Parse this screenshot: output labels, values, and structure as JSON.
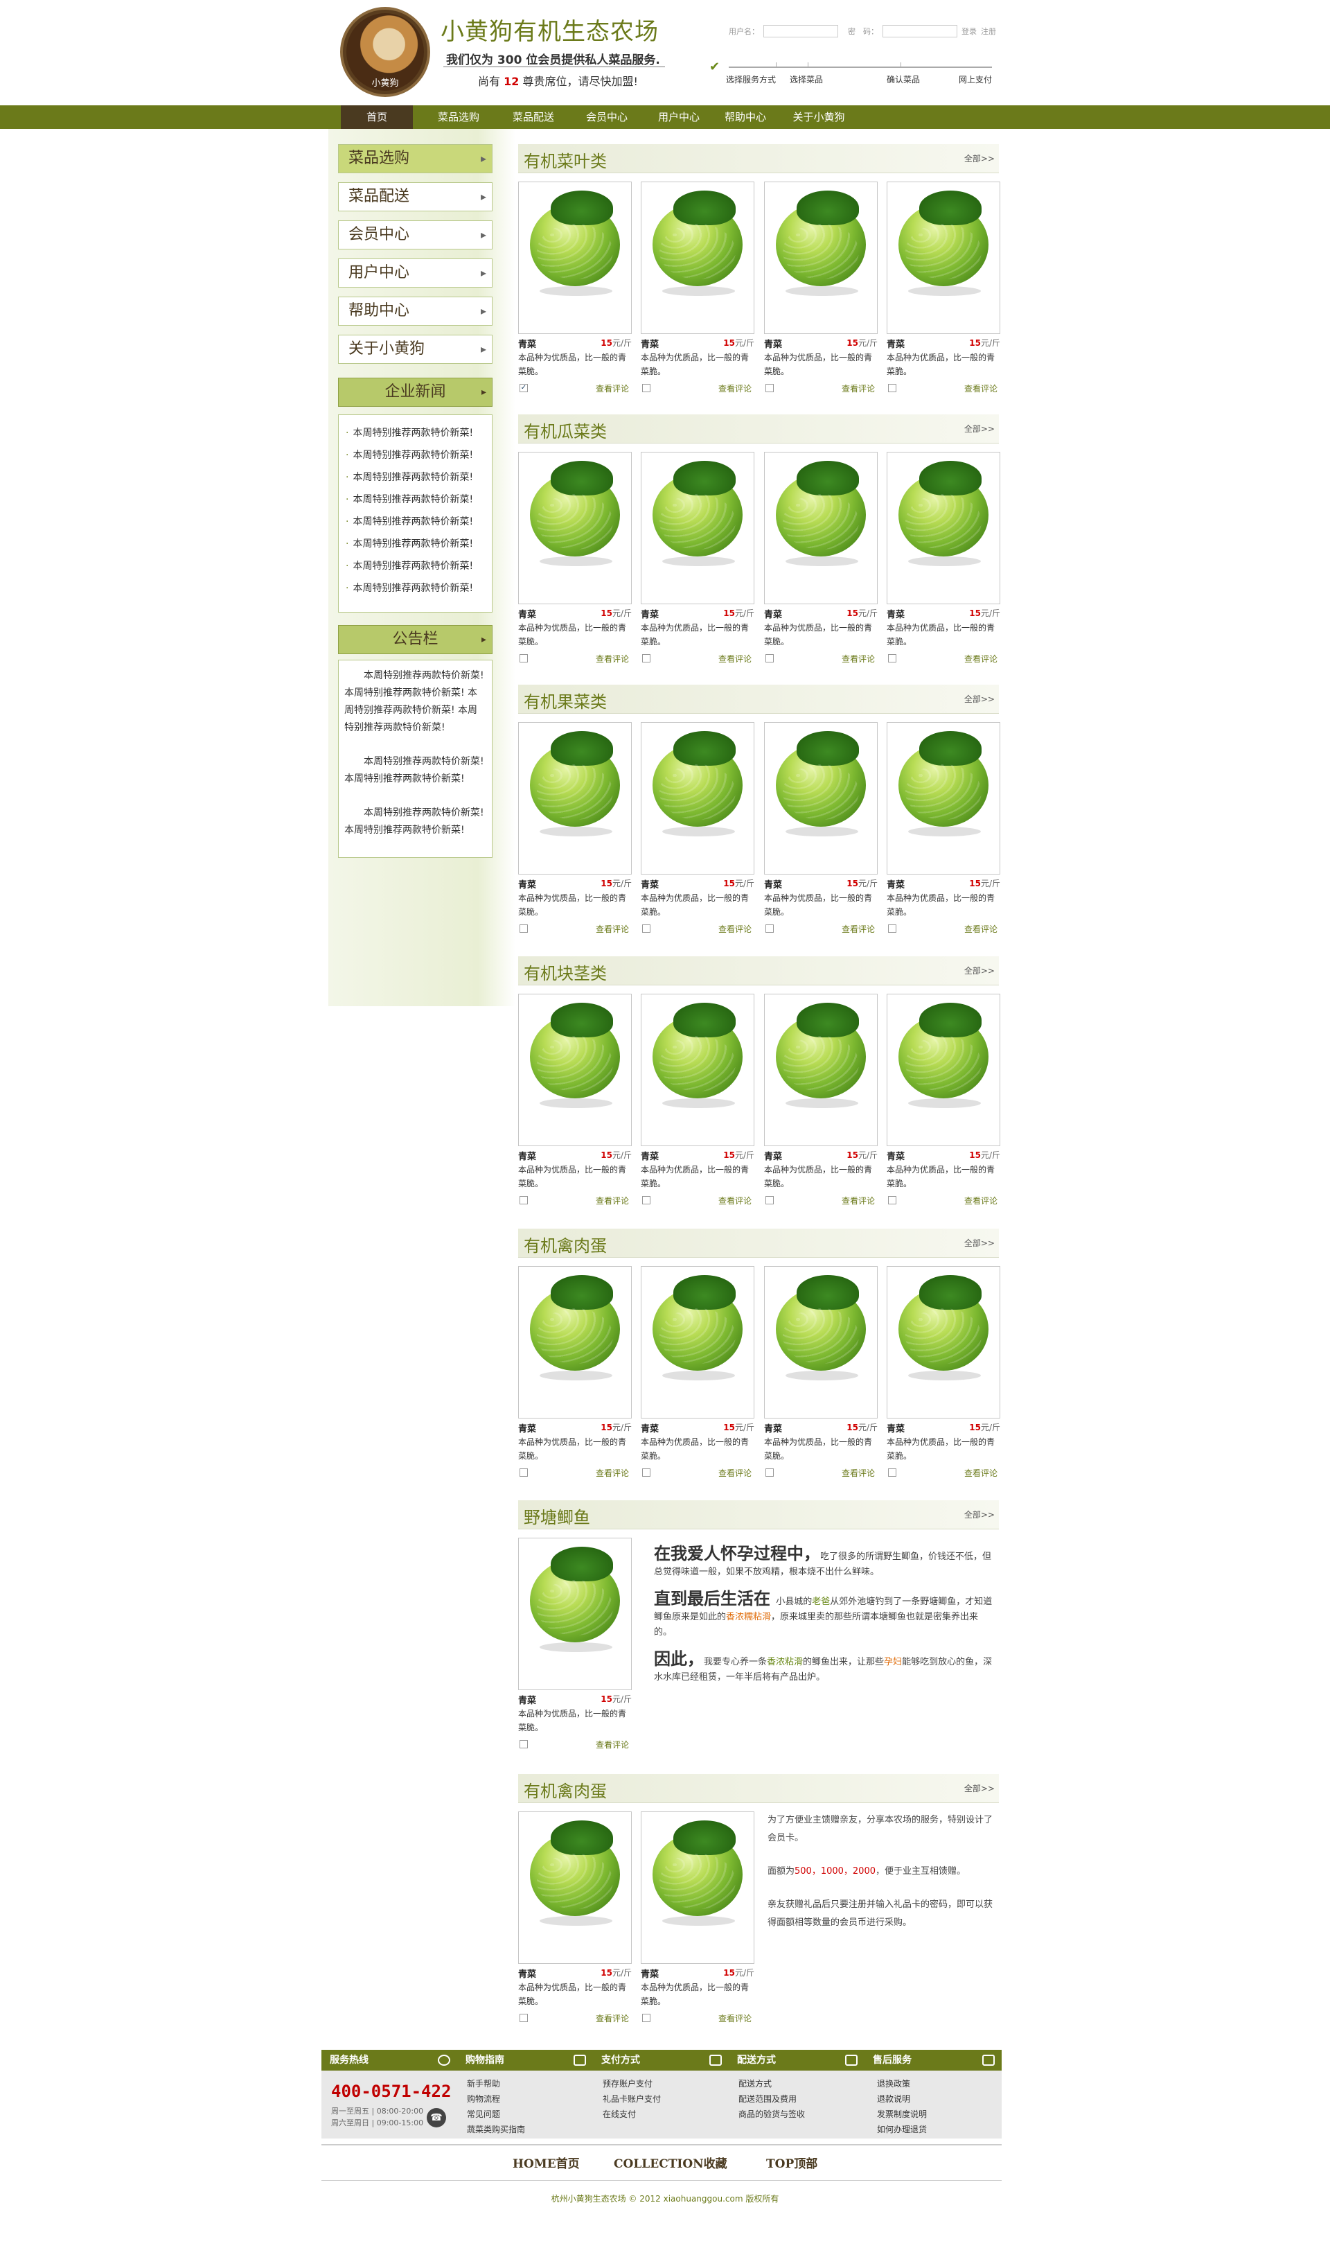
{
  "header": {
    "logo_text": "小黄狗",
    "site_title": "小黄狗有机生态农场",
    "slogan_line1": "我们仅为 300 位会员提供私人菜品服务.",
    "slogan_line2_pre": "尚有 ",
    "slogan_line2_num": "12",
    "slogan_line2_post": " 尊贵席位，请尽快加盟!",
    "login": {
      "username_label": "用户名：",
      "password_label": "密　码：",
      "login_link": "登录",
      "register_link": "注册"
    },
    "steps": [
      "选择服务方式",
      "选择菜品",
      "确认菜品",
      "网上支付"
    ]
  },
  "nav": [
    "首页",
    "菜品选购",
    "菜品配送",
    "会员中心",
    "用户中心",
    "帮助中心",
    "关于小黄狗"
  ],
  "sidebar": {
    "items": [
      "菜品选购",
      "菜品配送",
      "会员中心",
      "用户中心",
      "帮助中心",
      "关于小黄狗"
    ],
    "news_title": "企业新闻",
    "news": [
      "本周特别推荐两款特价新菜!",
      "本周特别推荐两款特价新菜!",
      "本周特别推荐两款特价新菜!",
      "本周特别推荐两款特价新菜!",
      "本周特别推荐两款特价新菜!",
      "本周特别推荐两款特价新菜!",
      "本周特别推荐两款特价新菜!",
      "本周特别推荐两款特价新菜!"
    ],
    "notice_title": "公告栏",
    "notice": [
      "本周特别推荐两款特价新菜! 本周特别推荐两款特价新菜! 本周特别推荐两款特价新菜! 本周特别推荐两款特价新菜!",
      "本周特别推荐两款特价新菜! 本周特别推荐两款特价新菜!",
      "本周特别推荐两款特价新菜! 本周特别推荐两款特价新菜!"
    ]
  },
  "product": {
    "name": "青菜",
    "price_num": "15",
    "price_unit": "元/斤",
    "desc": "本品种为优质品，比一般的青菜脆。",
    "review": "查看评论"
  },
  "sections": [
    {
      "title": "有机菜叶类",
      "more": "全部>>"
    },
    {
      "title": "有机瓜菜类",
      "more": "全部>>"
    },
    {
      "title": "有机果菜类",
      "more": "全部>>"
    },
    {
      "title": "有机块茎类",
      "more": "全部>>"
    },
    {
      "title": "有机禽肉蛋",
      "more": "全部>>"
    },
    {
      "title": "野塘鲫鱼",
      "more": "全部>>"
    },
    {
      "title": "有机禽肉蛋",
      "more": "全部>>"
    }
  ],
  "fish": {
    "h1": "在我爱人怀孕过程中，",
    "p1": "吃了很多的所谓野生鲫鱼，价钱还不低，但总觉得味道一般，如果不放鸡精，根本烧不出什么鲜味。",
    "h2": "直到最后生活在",
    "p2a": "小县城的",
    "p2b": "老爸",
    "p2c": "从郊外池塘钓到了一条野塘鲫鱼，才知道鲫鱼原来是如此的",
    "p2d": "香浓糯粘滑",
    "p2e": "，原来城里卖的那些所谓本塘鲫鱼也就是密集养出来的。",
    "h3": "因此，",
    "p3a": "我要专心养一条",
    "p3b": "香浓粘滑",
    "p3c": "的鲫鱼出来，让那些",
    "p3d": "孕妇",
    "p3e": "能够吃到放心的鱼，深水水库已经租赁，一年半后将有产品出炉。"
  },
  "promo": {
    "p1": "为了方便业主馈赠亲友，分享本农场的服务，特别设计了会员卡。",
    "p2a": "面额为",
    "p2b": "500，1000，2000",
    "p2c": "，便于业主互相馈赠。",
    "p3": "亲友获赠礼品后只要注册并输入礼品卡的密码，即可以获得面额相等数量的会员币进行采购。"
  },
  "footer": {
    "cols": [
      {
        "title": "服务热线",
        "items": []
      },
      {
        "title": "购物指南",
        "items": [
          "新手帮助",
          "购物流程",
          "常见问题",
          "蔬菜类购买指南"
        ]
      },
      {
        "title": "支付方式",
        "items": [
          "预存账户支付",
          "礼品卡账户支付",
          "在线支付"
        ]
      },
      {
        "title": "配送方式",
        "items": [
          "配送方式",
          "配送范围及费用",
          "商品的验货与签收"
        ]
      },
      {
        "title": "售后服务",
        "items": [
          "退换政策",
          "退款说明",
          "发票制度说明",
          "如何办理退货"
        ]
      }
    ],
    "hotline": "400-0571-422",
    "hours1": "周一至周五 | 08:00-20:00",
    "hours2": "周六至周日 | 09:00-15:00",
    "links": [
      "HOME首页",
      "COLLECTION收藏",
      "TOP顶部"
    ],
    "copyright": "杭州小黄狗生态农场 © 2012 xiaohuanggou.com 版权所有"
  }
}
